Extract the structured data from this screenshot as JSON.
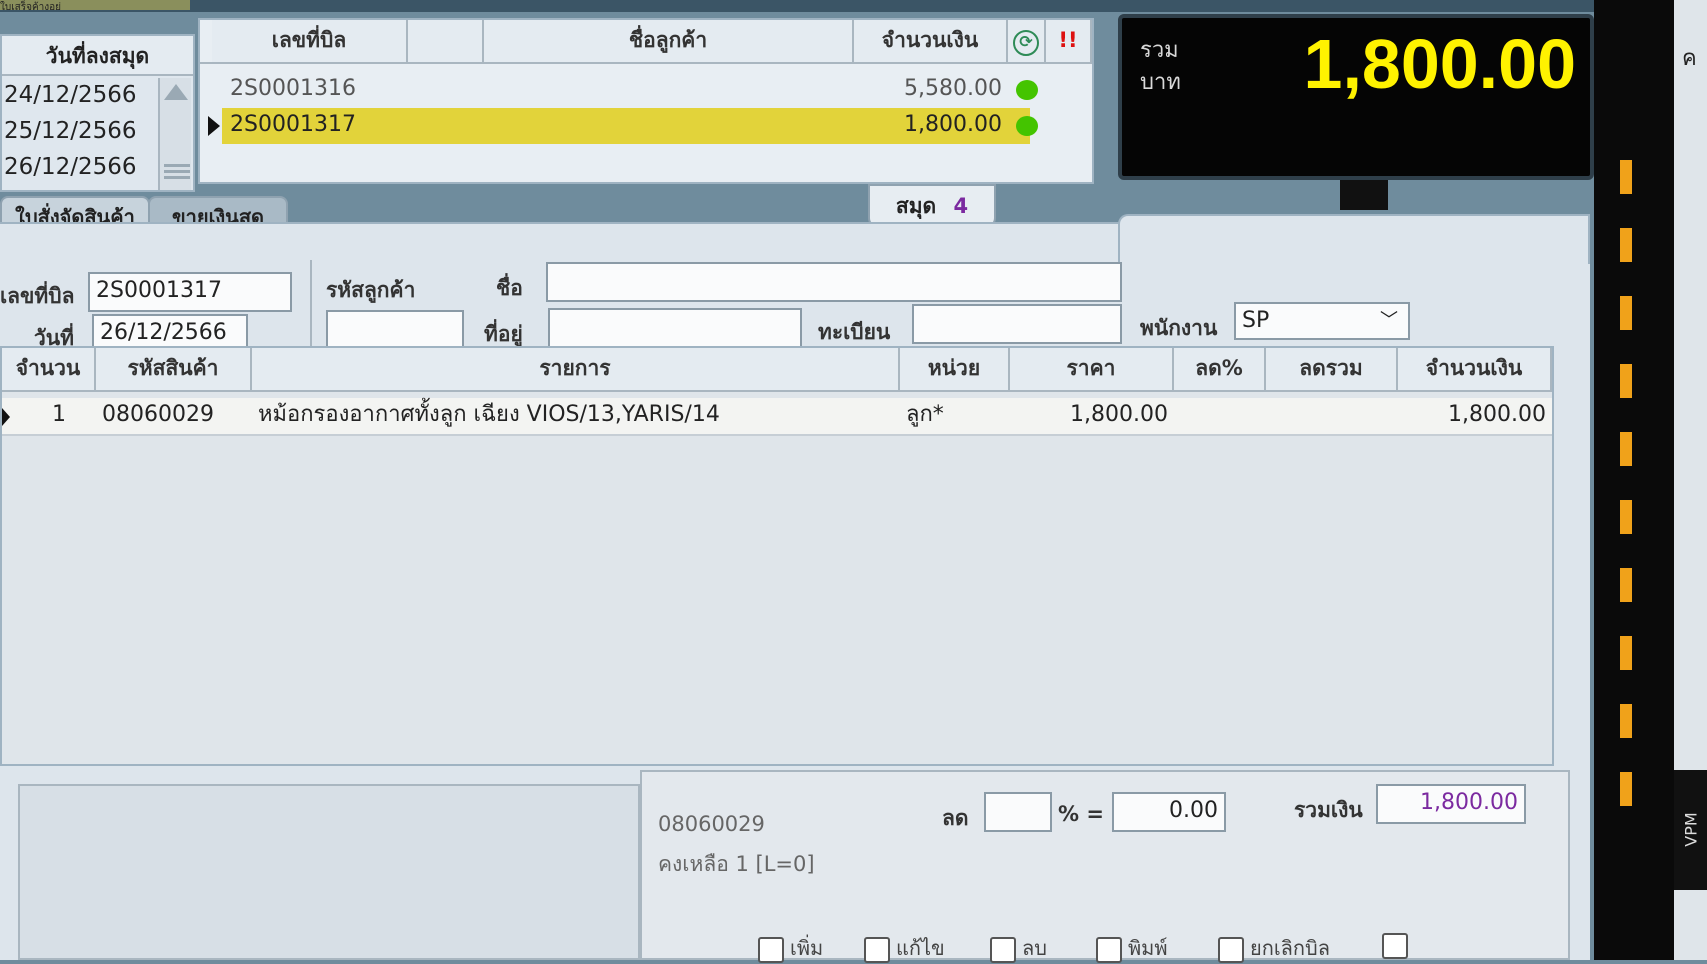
{
  "header_tab_top": "ใบเสร็จค้างอยู่",
  "dates_panel": {
    "header": "วันที่ลงสมุด",
    "dates": [
      "24/12/2566",
      "25/12/2566",
      "26/12/2566"
    ]
  },
  "bills_panel": {
    "columns": [
      "เลขที่บิล",
      "",
      "ชื่อลูกค้า",
      "จำนวนเงิน"
    ],
    "rows": [
      {
        "bill_no": "2S0001316",
        "customer": "",
        "amount": "5,580.00"
      },
      {
        "bill_no": "2S0001317",
        "customer": "",
        "amount": "1,800.00"
      }
    ],
    "refresh_icon": "refresh-icon",
    "alert_icon": "alert-icon",
    "status_color": "#44c400"
  },
  "total_display": {
    "label_1": "รวม",
    "label_2": "บาท",
    "value": "1,800.00"
  },
  "book_badge": {
    "label": "สมุด",
    "number": "4"
  },
  "tabs": [
    "ใบสั่งจัดสินค้า",
    "ขายเงินสด"
  ],
  "form": {
    "bill_no_label": "เลขที่บิล",
    "bill_no": "2S0001317",
    "date_label": "วันที่",
    "date": "26/12/2566",
    "customer_code_label": "รหัสลูกค้า",
    "customer_code": "",
    "name_label": "ชื่อ",
    "name": "",
    "address_label": "ที่อยู่",
    "address": "",
    "registration_label": "ทะเบียน",
    "registration": "",
    "employee_label": "พนักงาน",
    "employee": "SP"
  },
  "items_table": {
    "columns": [
      "จำนวน",
      "รหัสสินค้า",
      "รายการ",
      "หน่วย",
      "ราคา",
      "ลด%",
      "ลดรวม",
      "จำนวนเงิน"
    ],
    "rows": [
      {
        "qty": "1",
        "code": "08060029",
        "desc": "หม้อกรองอากาศทั้งลูก เฉียง VIOS/13,YARIS/14",
        "unit": "ลูก*",
        "price": "1,800.00",
        "disc_pct": "",
        "disc_total": "",
        "amount": "1,800.00"
      }
    ]
  },
  "footer": {
    "item_code": "08060029",
    "stock_text": "คงเหลือ 1 [L=0]",
    "discount_label": "ลด",
    "percent_label": "% =",
    "discount_pct": "",
    "discount_value": "0.00",
    "total_label": "รวมเงิน",
    "total_value": "1,800.00"
  },
  "toolbar": [
    "เพิ่ม",
    "แก้ไข",
    "ลบ",
    "พิมพ์",
    "ยกเลิกบิล"
  ],
  "right_edge_text": "ค",
  "vertical_label": "VPM",
  "colors": {
    "highlight": "#e2d33a",
    "total_bg": "#050505",
    "total_fg": "#fff200",
    "amount_purple": "#7b2aa0"
  }
}
